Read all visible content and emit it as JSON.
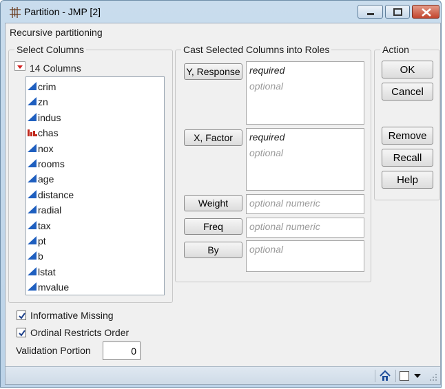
{
  "window": {
    "title": "Partition - JMP [2]",
    "subtitle": "Recursive partitioning"
  },
  "select_columns": {
    "legend": "Select Columns",
    "count_label": "14 Columns",
    "columns": [
      {
        "name": "crim",
        "type": "continuous"
      },
      {
        "name": "zn",
        "type": "continuous"
      },
      {
        "name": "indus",
        "type": "continuous"
      },
      {
        "name": "chas",
        "type": "nominal"
      },
      {
        "name": "nox",
        "type": "continuous"
      },
      {
        "name": "rooms",
        "type": "continuous"
      },
      {
        "name": "age",
        "type": "continuous"
      },
      {
        "name": "distance",
        "type": "continuous"
      },
      {
        "name": "radial",
        "type": "continuous"
      },
      {
        "name": "tax",
        "type": "continuous"
      },
      {
        "name": "pt",
        "type": "continuous"
      },
      {
        "name": "b",
        "type": "continuous"
      },
      {
        "name": "lstat",
        "type": "continuous"
      },
      {
        "name": "mvalue",
        "type": "continuous"
      }
    ]
  },
  "roles": {
    "legend": "Cast Selected Columns into Roles",
    "y_response": {
      "label": "Y, Response",
      "required": "required",
      "optional": "optional"
    },
    "x_factor": {
      "label": "X, Factor",
      "required": "required",
      "optional": "optional"
    },
    "weight": {
      "label": "Weight",
      "placeholder": "optional numeric"
    },
    "freq": {
      "label": "Freq",
      "placeholder": "optional numeric"
    },
    "by": {
      "label": "By",
      "placeholder": "optional"
    }
  },
  "action": {
    "legend": "Action",
    "ok": "OK",
    "cancel": "Cancel",
    "remove": "Remove",
    "recall": "Recall",
    "help": "Help"
  },
  "options": {
    "informative_missing": {
      "label": "Informative Missing",
      "checked": true
    },
    "ordinal_restricts": {
      "label": "Ordinal Restricts Order",
      "checked": true
    },
    "validation_label": "Validation Portion",
    "validation_value": "0"
  },
  "colors": {
    "continuous_icon": "#1f5fbf",
    "nominal_icon": "#c0281c"
  }
}
